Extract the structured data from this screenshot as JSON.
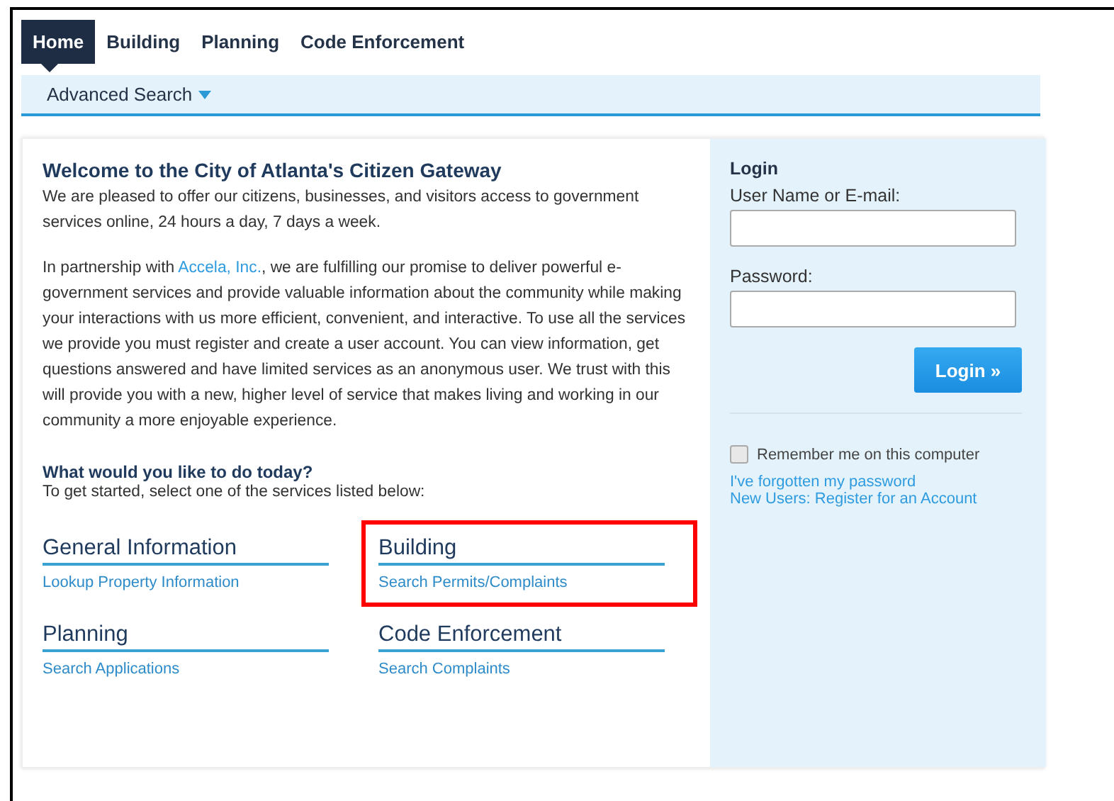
{
  "tabs": [
    {
      "label": "Home",
      "selected": true
    },
    {
      "label": "Building",
      "selected": false
    },
    {
      "label": "Planning",
      "selected": false
    },
    {
      "label": "Code Enforcement",
      "selected": false
    }
  ],
  "subnav": {
    "label": "Advanced Search"
  },
  "welcome": {
    "title": "Welcome to the City of Atlanta's Citizen Gateway",
    "paragraphs": [
      {
        "text": "We are pleased to offer our citizens, businesses, and visitors access to government services online, 24 hours a day, 7 days a week."
      },
      {
        "before": "In partnership with ",
        "link": "Accela, Inc.",
        "after": ", we are fulfilling our promise to deliver powerful e-government services and provide valuable information about the community while making your interactions with us more efficient, convenient, and interactive. To use all the services we provide you must register and create a user account. You can view information, get questions answered and have limited services as an anonymous user. We trust with this will provide you with a new, higher level of service that makes living and working in our community a more enjoyable experience."
      }
    ],
    "question": "What would you like to do today?",
    "prompt": "To get started, select one of the services listed below:"
  },
  "services": [
    {
      "title": "General Information",
      "link": "Lookup Property Information",
      "highlighted": false
    },
    {
      "title": "Building",
      "link": "Search Permits/Complaints",
      "highlighted": true
    },
    {
      "title": "Planning",
      "link": "Search Applications",
      "highlighted": false
    },
    {
      "title": "Code Enforcement",
      "link": "Search Complaints",
      "highlighted": false
    }
  ],
  "login": {
    "title": "Login",
    "username_label": "User Name or E-mail:",
    "password_label": "Password:",
    "button": "Login »",
    "remember": {
      "label": "Remember me on this computer",
      "checked": false
    },
    "forgot_link": "I've forgotten my password",
    "register_link": "New Users: Register for an Account"
  }
}
